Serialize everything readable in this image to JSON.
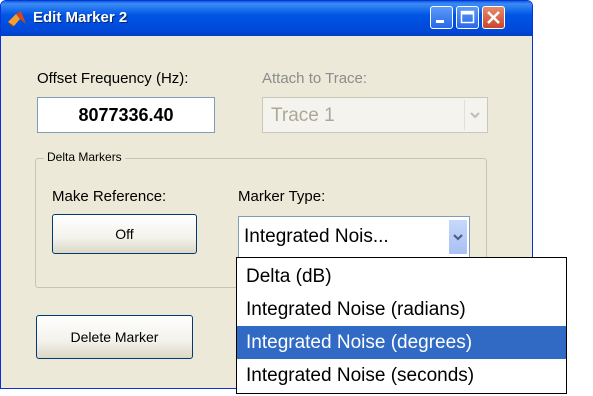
{
  "window": {
    "title": "Edit Marker 2"
  },
  "offset_frequency": {
    "label": "Offset Frequency (Hz):",
    "value": "8077336.40"
  },
  "attach_to_trace": {
    "label": "Attach to Trace:",
    "selected": "Trace 1"
  },
  "delta_markers": {
    "group_title": "Delta Markers",
    "make_reference_label": "Make Reference:",
    "make_reference_button": "Off",
    "marker_type_label": "Marker Type:",
    "marker_type_selected": "Integrated Nois..."
  },
  "delete_button": "Delete Marker",
  "marker_type_options": [
    "Delta (dB)",
    "Integrated Noise (radians)",
    "Integrated Noise (degrees)",
    "Integrated Noise (seconds)"
  ],
  "highlighted_option_index": 2,
  "icons": {
    "app": "matlab-icon",
    "minimize": "minimize-icon",
    "maximize": "maximize-icon",
    "close": "close-icon",
    "dropdown": "chevron-down-icon"
  },
  "colors": {
    "titlebar": "#0055e5",
    "selection": "#316ac5",
    "dialog_bg": "#ece9d8"
  }
}
